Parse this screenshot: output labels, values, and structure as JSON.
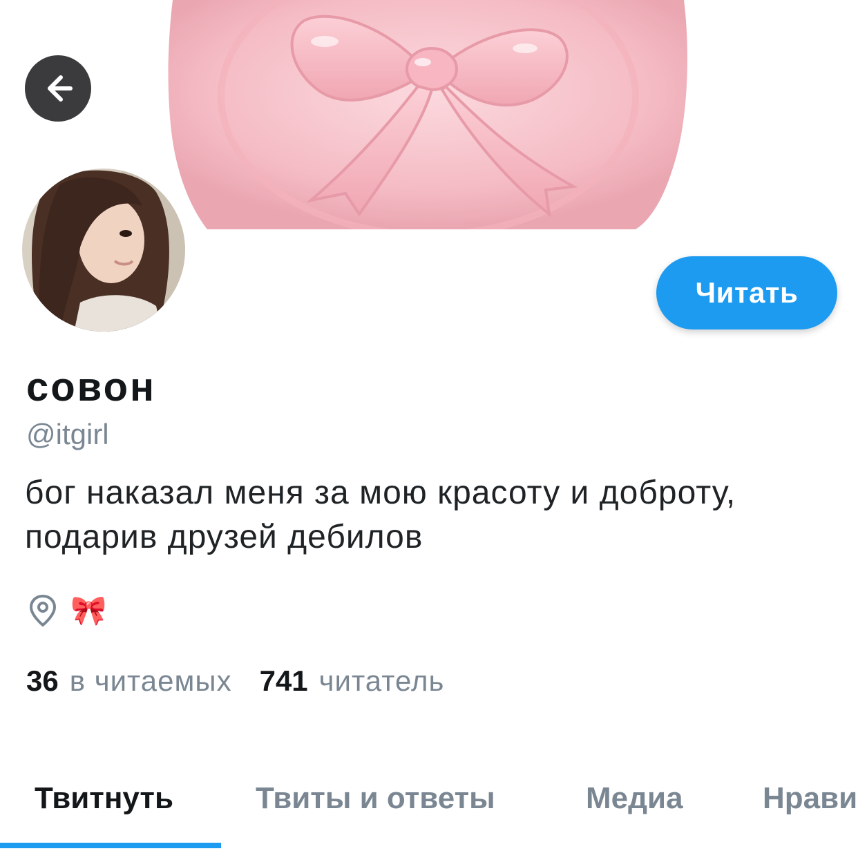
{
  "header": {
    "back_button_icon": "arrow-left-icon",
    "banner_image": "pink-wax-seal-bow-banner"
  },
  "profile": {
    "avatar": "profile-photo",
    "display_name": "совон",
    "handle": "@itgirl",
    "bio": "бог наказал меня за мою красоту и доброту, подарив друзей дебилов",
    "location_icon": "location-pin-icon",
    "location": "🎀",
    "follow_label": "Читать"
  },
  "stats": {
    "following_count": "36",
    "following_label": "в читаемых",
    "followers_count": "741",
    "followers_label": "читатель"
  },
  "tabs": [
    {
      "label": "Твитнуть",
      "active": true
    },
    {
      "label": "Твиты и ответы",
      "active": false
    },
    {
      "label": "Медиа",
      "active": false
    },
    {
      "label": "Нравится",
      "active": false
    }
  ],
  "colors": {
    "accent": "#1d9bf0",
    "text_primary": "#14171a",
    "text_secondary": "#7a8793",
    "banner_pink": "#f6c3cb"
  }
}
